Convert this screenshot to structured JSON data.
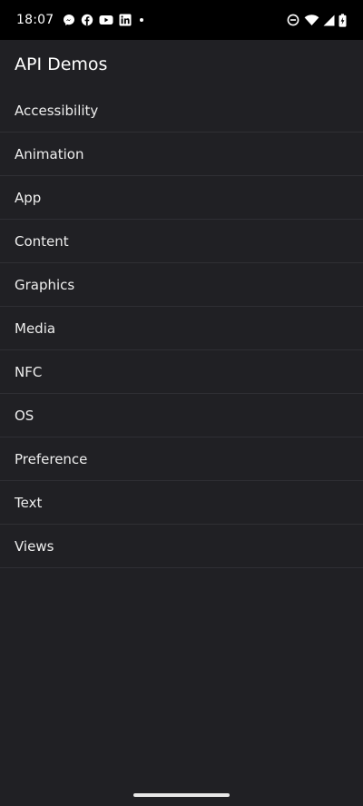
{
  "status_bar": {
    "time": "18:07",
    "notification_icons": [
      "messenger-icon",
      "facebook-icon",
      "youtube-icon",
      "linkedin-icon",
      "more-dot-icon"
    ],
    "system_icons": [
      "do-not-disturb-icon",
      "wifi-icon",
      "cellular-signal-icon",
      "battery-charging-icon"
    ]
  },
  "app_bar": {
    "title": "API Demos"
  },
  "list": {
    "items": [
      {
        "label": "Accessibility"
      },
      {
        "label": "Animation"
      },
      {
        "label": "App"
      },
      {
        "label": "Content"
      },
      {
        "label": "Graphics"
      },
      {
        "label": "Media"
      },
      {
        "label": "NFC"
      },
      {
        "label": "OS"
      },
      {
        "label": "Preference"
      },
      {
        "label": "Text"
      },
      {
        "label": "Views"
      }
    ]
  },
  "colors": {
    "background": "#202024",
    "status_bar": "#000000",
    "divider": "#2f2f34",
    "text": "#ffffff"
  }
}
